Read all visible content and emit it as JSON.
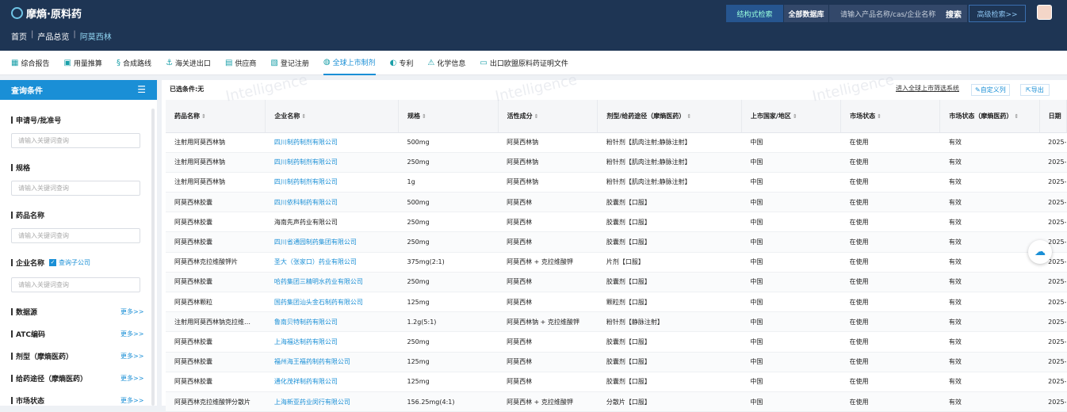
{
  "header": {
    "logo": "摩熵·原料药",
    "search_struct": "结构式检索",
    "db_scope": "全部数据库",
    "search_placeholder": "请输入产品名称/cas/企业名称",
    "search_btn": "搜索",
    "advanced": "高级检索>>"
  },
  "breadcrumb": [
    "首页",
    "产品总览",
    "阿莫西林"
  ],
  "tabs": [
    {
      "label": "综合报告",
      "icon": "▦"
    },
    {
      "label": "用量推算",
      "icon": "▣"
    },
    {
      "label": "合成路线",
      "icon": "§"
    },
    {
      "label": "海关进出口",
      "icon": "⚓"
    },
    {
      "label": "供应商",
      "icon": "▤"
    },
    {
      "label": "登记注册",
      "icon": "▧"
    },
    {
      "label": "全球上市制剂",
      "icon": "◍"
    },
    {
      "label": "专利",
      "icon": "◐"
    },
    {
      "label": "化学信息",
      "icon": "⚠"
    },
    {
      "label": "出口欧盟原料药证明文件",
      "icon": "▭"
    }
  ],
  "sidebar": {
    "title": "查询条件",
    "filters": {
      "f1": "申请号/批准号",
      "f2": "规格",
      "f3": "药品名称",
      "f4": "企业名称",
      "f5": "数据源",
      "f6": "ATC编码",
      "f7": "剂型（摩熵医药）",
      "f8": "给药途径（摩熵医药）",
      "f9": "市场状态"
    },
    "placeholder": "请输入关键词查询",
    "subsidiary": "查询子公司",
    "more": "更多>>"
  },
  "toolbar": {
    "conditions": "已选条件:无",
    "filter_sys": "进入全球上市筛选系统",
    "custom_cols": "自定义列",
    "export": "导出"
  },
  "table": {
    "headers": [
      "药品名称",
      "企业名称",
      "规格",
      "活性成分",
      "剂型/给药途径（摩熵医药）",
      "上市国家/地区",
      "市场状态",
      "市场状态（摩熵医药）",
      "日期"
    ],
    "rows": [
      [
        "注射用阿莫西林钠",
        "四川制药制剂有限公司",
        "500mg",
        "阿莫西林钠",
        "粉针剂【肌肉注射;静脉注射】",
        "中国",
        "在使用",
        "有效",
        "2025-"
      ],
      [
        "注射用阿莫西林钠",
        "四川制药制剂有限公司",
        "250mg",
        "阿莫西林钠",
        "粉针剂【肌肉注射;静脉注射】",
        "中国",
        "在使用",
        "有效",
        "2025-"
      ],
      [
        "注射用阿莫西林钠",
        "四川制药制剂有限公司",
        "1g",
        "阿莫西林钠",
        "粉针剂【肌肉注射;静脉注射】",
        "中国",
        "在使用",
        "有效",
        "2025-"
      ],
      [
        "阿莫西林胶囊",
        "四川依科制药有限公司",
        "500mg",
        "阿莫西林",
        "胶囊剂【口服】",
        "中国",
        "在使用",
        "有效",
        "2025-"
      ],
      [
        "阿莫西林胶囊",
        "海南先声药业有限公司",
        "250mg",
        "阿莫西林",
        "胶囊剂【口服】",
        "中国",
        "在使用",
        "有效",
        "2025-"
      ],
      [
        "阿莫西林胶囊",
        "四川省通园制药集团有限公司",
        "250mg",
        "阿莫西林",
        "胶囊剂【口服】",
        "中国",
        "在使用",
        "有效",
        "2025-"
      ],
      [
        "阿莫西林克拉维酸钾片",
        "圣大（张家口）药业有限公司",
        "375mg(2:1)",
        "阿莫西林 + 克拉维酸钾",
        "片剂【口服】",
        "中国",
        "在使用",
        "有效",
        "2025-"
      ],
      [
        "阿莫西林胶囊",
        "哈药集团三精明水药业有限公司",
        "250mg",
        "阿莫西林",
        "胶囊剂【口服】",
        "中国",
        "在使用",
        "有效",
        "2025-"
      ],
      [
        "阿莫西林颗粒",
        "国药集团汕头金石制药有限公司",
        "125mg",
        "阿莫西林",
        "颗粒剂【口服】",
        "中国",
        "在使用",
        "有效",
        "2025-"
      ],
      [
        "注射用阿莫西林钠克拉维…",
        "鲁南贝特制药有限公司",
        "1.2g(5:1)",
        "阿莫西林钠 + 克拉维酸钾",
        "粉针剂【静脉注射】",
        "中国",
        "在使用",
        "有效",
        "2025-"
      ],
      [
        "阿莫西林胶囊",
        "上海福达制药有限公司",
        "250mg",
        "阿莫西林",
        "胶囊剂【口服】",
        "中国",
        "在使用",
        "有效",
        "2025-"
      ],
      [
        "阿莫西林胶囊",
        "福州海王福药制药有限公司",
        "125mg",
        "阿莫西林",
        "胶囊剂【口服】",
        "中国",
        "在使用",
        "有效",
        "2025-"
      ],
      [
        "阿莫西林胶囊",
        "通化茂祥制药有限公司",
        "125mg",
        "阿莫西林",
        "胶囊剂【口服】",
        "中国",
        "在使用",
        "有效",
        "2025-"
      ],
      [
        "阿莫西林克拉维酸钾分散片",
        "上海新亚药业闵行有限公司",
        "156.25mg(4:1)",
        "阿莫西林 + 克拉维酸钾",
        "分散片【口服】",
        "中国",
        "在使用",
        "有效",
        "2025-"
      ]
    ]
  },
  "icons": {
    "upload": "cloud-upload-icon"
  },
  "watermark": "Intelligence"
}
